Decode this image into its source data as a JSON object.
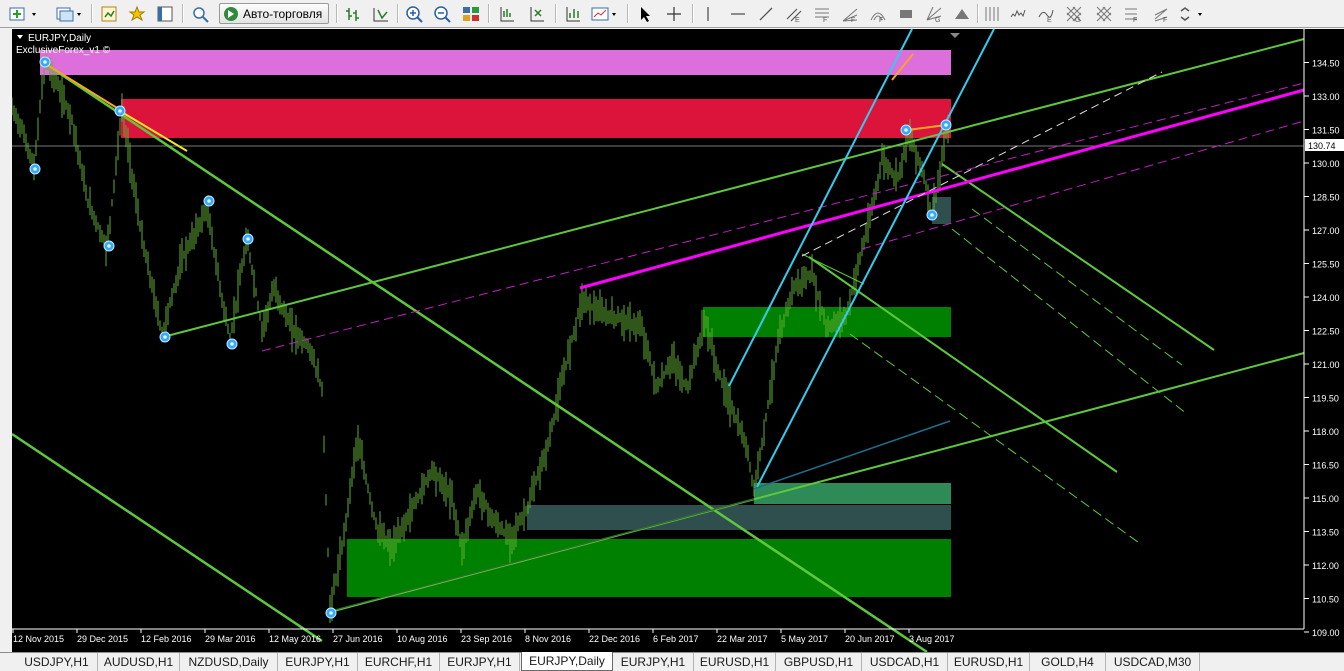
{
  "toolbar": {
    "autotrade_label": "Авто-торговля",
    "icons": [
      "new-order-icon",
      "profiles-icon",
      "market-watch-icon",
      "navigator-icon",
      "terminal-icon",
      "strategy-tester-icon",
      "autotrade-icon",
      "bar-chart-icon",
      "candlestick-icon",
      "line-chart-icon",
      "zoom-in-icon",
      "zoom-out-icon",
      "tile-windows-icon",
      "chart-shift-icon",
      "autoscroll-icon",
      "periods-icon",
      "templates-icon",
      "cursor-icon",
      "crosshair-icon",
      "horizontal-line-icon",
      "trendline-icon",
      "equidistant-channel-icon",
      "fibonacci-retracement-icon",
      "fibonacci-fan-icon",
      "fibonacci-arcs-icon",
      "rectangle-icon",
      "gann-fan-icon",
      "triangle-icon",
      "andrews-pitchfork-icon",
      "cycle-lines-icon",
      "text-label-icon",
      "gann-grid-icon",
      "fibonacci-expansion-icon",
      "fibonacci-channel-icon",
      "arrows-icon"
    ]
  },
  "chart": {
    "header": "EURJPY,Daily",
    "indicator": "ExclusiveForex_v1 ©",
    "current_price": "130.74",
    "price_labels": [
      "134.50",
      "133.00",
      "131.50",
      "130.00",
      "128.50",
      "127.00",
      "125.50",
      "124.00",
      "122.50",
      "121.00",
      "119.50",
      "118.00",
      "116.50",
      "115.00",
      "113.50",
      "112.00",
      "110.50",
      "109.00"
    ],
    "date_labels": [
      "12 Nov 2015",
      "29 Dec 2015",
      "12 Feb 2016",
      "29 Mar 2016",
      "12 May 2016",
      "27 Jun 2016",
      "10 Aug 2016",
      "23 Sep 2016",
      "8 Nov 2016",
      "22 Dec 2016",
      "6 Feb 2017",
      "22 Mar 2017",
      "5 May 2017",
      "20 Jun 2017",
      "3 Aug 2017"
    ],
    "colors": {
      "background": "#000000",
      "candles": "#5fae32",
      "pink_zone": "#dd6fdd",
      "red_zone": "#dc143c",
      "green_zone": "#008000",
      "channel": "#5ec83c",
      "magenta": "#ff00ff",
      "cyan": "#33ccee"
    }
  },
  "tabs": [
    {
      "label": "USDJPY,H1"
    },
    {
      "label": "AUDUSD,H1"
    },
    {
      "label": "NZDUSD,Daily"
    },
    {
      "label": "EURJPY,H1"
    },
    {
      "label": "EURCHF,H1"
    },
    {
      "label": "EURJPY,H1"
    },
    {
      "label": "EURJPY,Daily",
      "active": true
    },
    {
      "label": "EURJPY,H1"
    },
    {
      "label": "EURUSD,H1"
    },
    {
      "label": "GBPUSD,H1"
    },
    {
      "label": "USDCAD,H1"
    },
    {
      "label": "EURUSD,H1"
    },
    {
      "label": "GOLD,H4"
    },
    {
      "label": "USDCAD,M30"
    }
  ]
}
